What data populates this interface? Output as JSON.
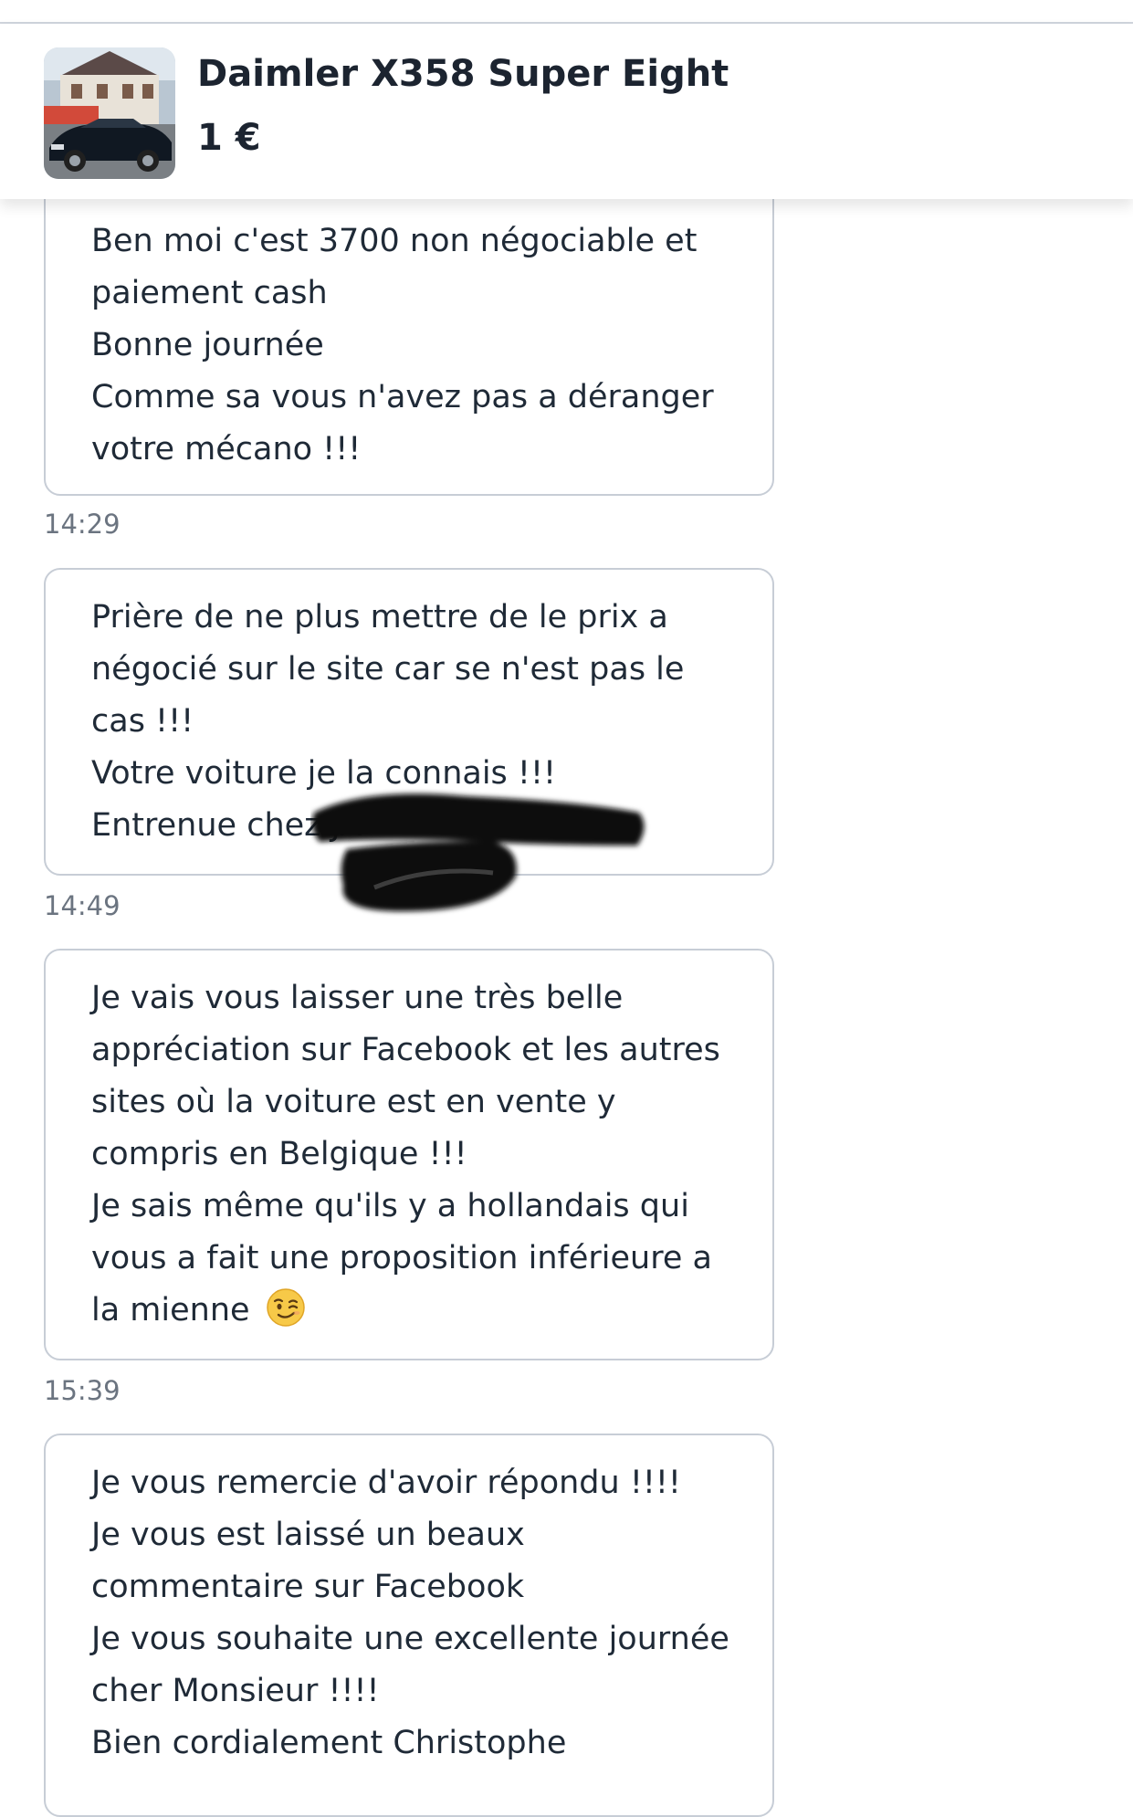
{
  "listing": {
    "title": "Daimler X358 Super Eight",
    "price": "1 €",
    "thumbnail_icon": "car-photo"
  },
  "messages": [
    {
      "lines": [
        "Ben moi c'est 3700 non négociable et",
        "paiement cash",
        "Bonne journée",
        "Comme sa vous n'avez pas a déranger",
        "votre mécano !!!"
      ],
      "time": "14:29"
    },
    {
      "lines": [
        "Prière de ne plus mettre de le prix a",
        "négocié sur le site car se n'est pas le",
        "cas !!!",
        "Votre voiture je la connais !!!",
        "Entrenue chez JA"
      ],
      "time": "14:49",
      "redacted": true
    },
    {
      "lines": [
        "Je vais vous laisser une très belle",
        "appréciation sur Facebook et les autres",
        "sites où la voiture est en vente y",
        "compris en Belgique !!!",
        "Je sais même qu'ils y a hollandais qui",
        "vous a fait une proposition inférieure a",
        "la mienne"
      ],
      "emoji": "winking-face-icon",
      "time": "15:39"
    },
    {
      "lines": [
        "Je vous remercie d'avoir répondu !!!!",
        "Je vous est laissé un beaux",
        "commentaire sur Facebook",
        "Je vous souhaite une excellente journée",
        "cher Monsieur !!!!",
        "Bien cordialement Christophe"
      ]
    }
  ],
  "colors": {
    "bubble_border": "#c7cdd6",
    "text": "#1f2a37",
    "timestamp": "#6b7480"
  }
}
